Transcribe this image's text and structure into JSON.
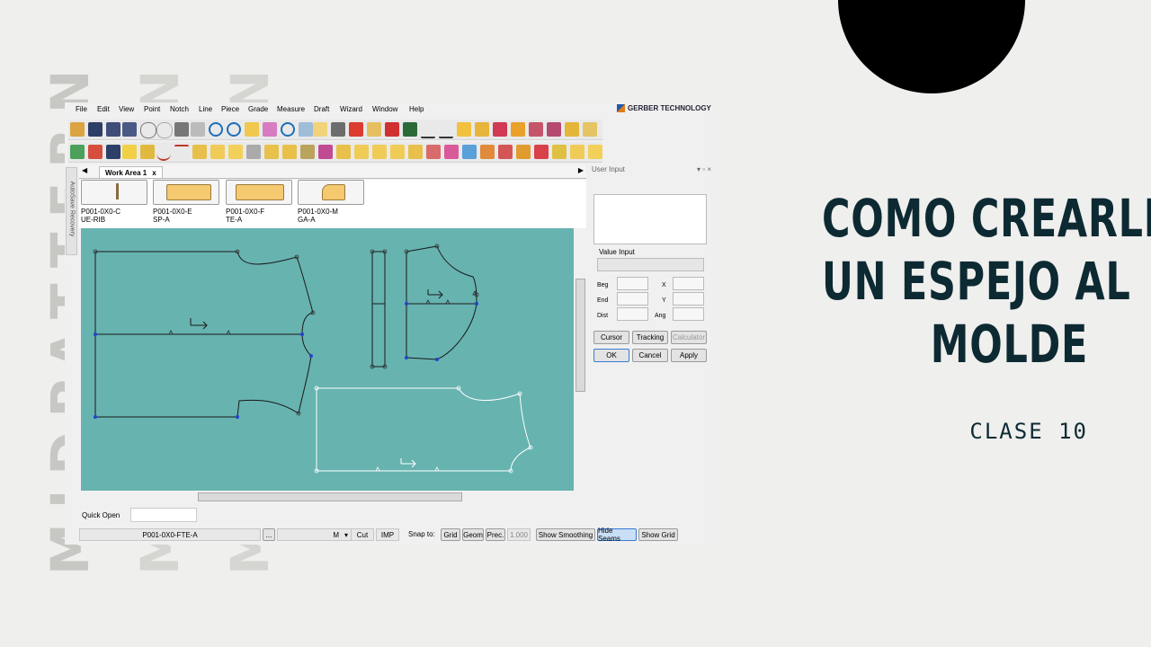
{
  "overlay": {
    "title_lines": [
      "COMO CREARLE",
      "UN ESPEJO AL",
      "MOLDE"
    ],
    "subtitle": "CLASE 10",
    "watermark_text": "MIDPATTERNS",
    "colors": {
      "background": "#efefed",
      "title": "#0d2a33",
      "circle": "#000000",
      "watermark": "#c7c7c4"
    }
  },
  "app": {
    "brand": "GERBER TECHNOLOGY",
    "menu": [
      "File",
      "Edit",
      "View",
      "Point",
      "Notch",
      "Line",
      "Piece",
      "Grade",
      "Measure",
      "Draft",
      "Wizard",
      "Window",
      "Help"
    ],
    "work_tab": "Work Area 1",
    "tab_close": "x",
    "autosave_label": "AutoSave Recovery",
    "pieces": [
      {
        "line1": "P001-0X0-C",
        "line2": "UE-RIB"
      },
      {
        "line1": "P001-0X0-E",
        "line2": "SP-A"
      },
      {
        "line1": "P001-0X0-F",
        "line2": "TE-A"
      },
      {
        "line1": "P001-0X0-M",
        "line2": "GA-A"
      }
    ],
    "canvas_color": "#67b3b0",
    "user_input": {
      "title": "User Input",
      "value_input_label": "Value Input",
      "labels": {
        "beg": "Beg",
        "end": "End",
        "dist": "Dist",
        "x": "X",
        "y": "Y",
        "ang": "Ang"
      },
      "buttons": {
        "cursor": "Cursor",
        "tracking": "Tracking",
        "calculator": "Calculator",
        "ok": "OK",
        "cancel": "Cancel",
        "apply": "Apply"
      }
    },
    "status": {
      "quick_open": "Quick Open",
      "piece_name": "P001-0X0-FTE-A",
      "ellipsis": "...",
      "size": "M",
      "cut": "Cut",
      "units": "IMP",
      "snap_to": "Snap to:",
      "grid": "Grid",
      "geom": "Geom",
      "prec": "Prec.",
      "prec_value": "1.000",
      "show_smoothing": "Show Smoothing",
      "hide_seams": "Hide Seams",
      "show_grid": "Show Grid"
    }
  }
}
